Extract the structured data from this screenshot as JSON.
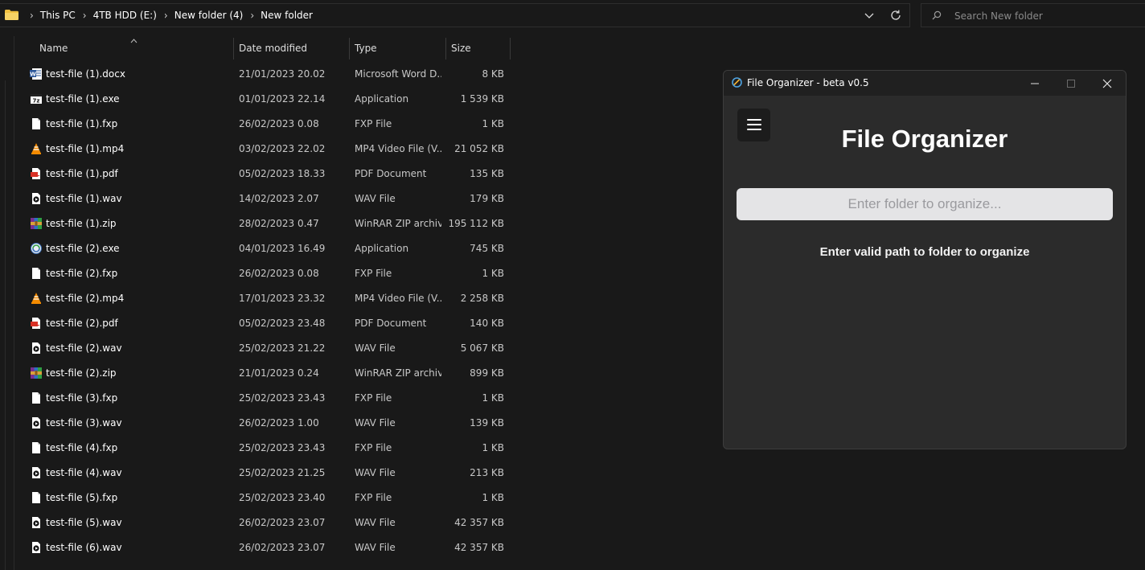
{
  "address_bar": {
    "crumbs": [
      "This PC",
      "4TB HDD (E:)",
      "New folder (4)",
      "New folder"
    ]
  },
  "search": {
    "placeholder": "Search New folder"
  },
  "columns": {
    "name": "Name",
    "date": "Date modified",
    "type": "Type",
    "size": "Size"
  },
  "files": [
    {
      "name": "test-file (1).docx",
      "date": "21/01/2023 20.02",
      "type": "Microsoft Word D...",
      "size": "8 KB",
      "icon": "docx"
    },
    {
      "name": "test-file (1).exe",
      "date": "01/01/2023 22.14",
      "type": "Application",
      "size": "1 539 KB",
      "icon": "exe1"
    },
    {
      "name": "test-file (1).fxp",
      "date": "26/02/2023 0.08",
      "type": "FXP File",
      "size": "1 KB",
      "icon": "blank"
    },
    {
      "name": "test-file (1).mp4",
      "date": "03/02/2023 22.02",
      "type": "MP4 Video File (V...",
      "size": "21 052 KB",
      "icon": "vlc"
    },
    {
      "name": "test-file (1).pdf",
      "date": "05/02/2023 18.33",
      "type": "PDF Document",
      "size": "135 KB",
      "icon": "pdf"
    },
    {
      "name": "test-file (1).wav",
      "date": "14/02/2023 2.07",
      "type": "WAV File",
      "size": "179 KB",
      "icon": "wav"
    },
    {
      "name": "test-file (1).zip",
      "date": "28/02/2023 0.47",
      "type": "WinRAR ZIP archive",
      "size": "195 112 KB",
      "icon": "zip"
    },
    {
      "name": "test-file (2).exe",
      "date": "04/01/2023 16.49",
      "type": "Application",
      "size": "745 KB",
      "icon": "exe2"
    },
    {
      "name": "test-file (2).fxp",
      "date": "26/02/2023 0.08",
      "type": "FXP File",
      "size": "1 KB",
      "icon": "blank"
    },
    {
      "name": "test-file (2).mp4",
      "date": "17/01/2023 23.32",
      "type": "MP4 Video File (V...",
      "size": "2 258 KB",
      "icon": "vlc"
    },
    {
      "name": "test-file (2).pdf",
      "date": "05/02/2023 23.48",
      "type": "PDF Document",
      "size": "140 KB",
      "icon": "pdf"
    },
    {
      "name": "test-file (2).wav",
      "date": "25/02/2023 21.22",
      "type": "WAV File",
      "size": "5 067 KB",
      "icon": "wav"
    },
    {
      "name": "test-file (2).zip",
      "date": "21/01/2023 0.24",
      "type": "WinRAR ZIP archive",
      "size": "899 KB",
      "icon": "zip"
    },
    {
      "name": "test-file (3).fxp",
      "date": "25/02/2023 23.43",
      "type": "FXP File",
      "size": "1 KB",
      "icon": "blank"
    },
    {
      "name": "test-file (3).wav",
      "date": "26/02/2023 1.00",
      "type": "WAV File",
      "size": "139 KB",
      "icon": "wav"
    },
    {
      "name": "test-file (4).fxp",
      "date": "25/02/2023 23.43",
      "type": "FXP File",
      "size": "1 KB",
      "icon": "blank"
    },
    {
      "name": "test-file (4).wav",
      "date": "25/02/2023 21.25",
      "type": "WAV File",
      "size": "213 KB",
      "icon": "wav"
    },
    {
      "name": "test-file (5).fxp",
      "date": "25/02/2023 23.40",
      "type": "FXP File",
      "size": "1 KB",
      "icon": "blank"
    },
    {
      "name": "test-file (5).wav",
      "date": "26/02/2023 23.07",
      "type": "WAV File",
      "size": "42 357 KB",
      "icon": "wav"
    },
    {
      "name": "test-file (6).wav",
      "date": "26/02/2023 23.07",
      "type": "WAV File",
      "size": "42 357 KB",
      "icon": "wav"
    }
  ],
  "app": {
    "window_title": "File Organizer - beta v0.5",
    "heading": "File Organizer",
    "input_placeholder": "Enter folder to organize...",
    "message": "Enter valid path to folder to organize",
    "input_bg": "#e4e4e6",
    "window_bg": "#2b2b2b"
  }
}
